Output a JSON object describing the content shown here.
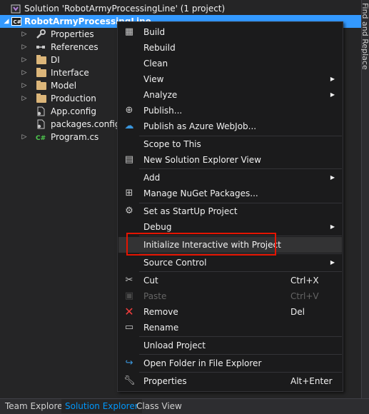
{
  "tree": {
    "solution_label": "Solution 'RobotArmyProcessingLine' (1 project)",
    "project_label": "RobotArmyProcessingLine",
    "items": [
      {
        "label": "Properties",
        "icon": "wrench-icon"
      },
      {
        "label": "References",
        "icon": "references-icon"
      },
      {
        "label": "DI",
        "icon": "folder-icon"
      },
      {
        "label": "Interface",
        "icon": "folder-icon"
      },
      {
        "label": "Model",
        "icon": "folder-icon"
      },
      {
        "label": "Production",
        "icon": "folder-icon"
      },
      {
        "label": "App.config",
        "icon": "config-file-icon"
      },
      {
        "label": "packages.config",
        "icon": "config-file-icon"
      },
      {
        "label": "Program.cs",
        "icon": "csharp-file-icon"
      }
    ]
  },
  "side_strip": {
    "label": "Find and Replace"
  },
  "menu": {
    "build": "Build",
    "rebuild": "Rebuild",
    "clean": "Clean",
    "view": "View",
    "analyze": "Analyze",
    "publish": "Publish...",
    "publish_azure": "Publish as Azure WebJob...",
    "scope": "Scope to This",
    "new_view": "New Solution Explorer View",
    "add": "Add",
    "nuget": "Manage NuGet Packages...",
    "startup": "Set as StartUp Project",
    "debug": "Debug",
    "interactive": "Initialize Interactive with Project",
    "source_control": "Source Control",
    "cut": "Cut",
    "cut_shortcut": "Ctrl+X",
    "paste": "Paste",
    "paste_shortcut": "Ctrl+V",
    "remove": "Remove",
    "remove_shortcut": "Del",
    "rename": "Rename",
    "unload": "Unload Project",
    "open_folder": "Open Folder in File Explorer",
    "properties": "Properties",
    "properties_shortcut": "Alt+Enter"
  },
  "tabs": {
    "team_explorer": "Team Explorer",
    "solution_explorer": "Solution Explorer",
    "class_view": "Class View"
  },
  "colors": {
    "selection": "#3399ff",
    "highlight_box": "#e51400",
    "active_tab": "#0097fb",
    "background": "#252526"
  }
}
